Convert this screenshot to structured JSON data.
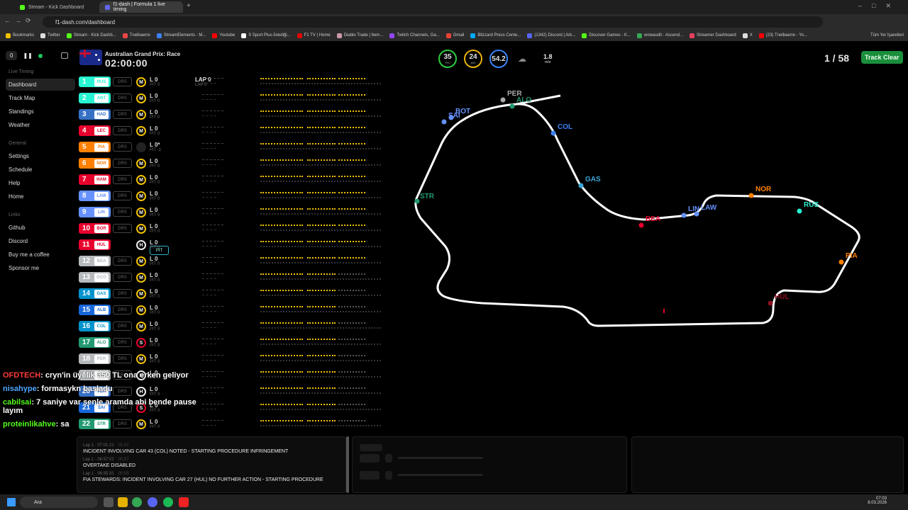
{
  "browser": {
    "tabs": [
      {
        "title": "Stream - Kick Dashboard",
        "active": false
      },
      {
        "title": "f1-dash | Formula 1 live timing",
        "active": true
      }
    ],
    "url": "f1-dash.com/dashboard",
    "bookmarks": [
      "Bookmarks",
      "Twitter",
      "Stream - Kick Dashb...",
      "Tnelbaerre",
      "StreamElements - M...",
      "Youtube",
      "S Sport Plus-İstediği...",
      "F1 TV | Home",
      "Diablo Trade | Item...",
      "Twitch Channels, Ga...",
      "Gmail",
      "Blizzard Press Cente...",
      "(1342) Discord | Ark...",
      "Discover Games - K...",
      "wowaudit - Ascend...",
      "Streamer Dashboard",
      "X",
      "(23) Tnelbaerre - Yo..."
    ],
    "all_bookmarks": "Tüm Yer İşaretleri"
  },
  "controls": {
    "counter": "0"
  },
  "sidebar": {
    "sections": [
      {
        "title": "Live Timing",
        "items": [
          "Dashboard",
          "Track Map",
          "Standings",
          "Weather"
        ]
      },
      {
        "title": "General",
        "items": [
          "Settings",
          "Schedule",
          "Help",
          "Home"
        ]
      },
      {
        "title": "Links",
        "items": [
          "Github",
          "Discord",
          "Buy me a coffee",
          "Sponsor me"
        ]
      }
    ],
    "active": "Dashboard"
  },
  "header": {
    "race": "Australian Grand Prix: Race",
    "clock": "02:00:00",
    "trc": "35",
    "trc_label": "TRC",
    "air": "24",
    "air_label": "AIR",
    "hum": "54.2",
    "wind": "1.8",
    "wind_unit": "m/s",
    "laps": "1 / 58",
    "status": "Track Clear"
  },
  "leader": {
    "lap": "LAP 0",
    "lap_sub": "LAP 0"
  },
  "drivers": [
    {
      "pos": "1",
      "code": "RUS",
      "color": "#27f4d2",
      "drs": "DRS",
      "tyre": "M",
      "lap": "L 0",
      "pit": "PIT 0"
    },
    {
      "pos": "2",
      "code": "ANT",
      "color": "#27f4d2",
      "drs": "DRS",
      "tyre": "M",
      "lap": "L 0",
      "pit": "PIT 0"
    },
    {
      "pos": "3",
      "code": "HAD",
      "color": "#3671c6",
      "drs": "DRS",
      "tyre": "M",
      "lap": "L 0",
      "pit": "PIT 0"
    },
    {
      "pos": "4",
      "code": "LEC",
      "color": "#e8002d",
      "drs": "DRS",
      "tyre": "M",
      "lap": "L 0",
      "pit": "PIT 0"
    },
    {
      "pos": "5",
      "code": "PIA",
      "color": "#ff8000",
      "drs": "DRS",
      "tyre": "",
      "lap": "L 0*",
      "pit": "PIT -1"
    },
    {
      "pos": "6",
      "code": "NOR",
      "color": "#ff8000",
      "drs": "DRS",
      "tyre": "M",
      "lap": "L 0",
      "pit": "PIT 0"
    },
    {
      "pos": "7",
      "code": "HAM",
      "color": "#e8002d",
      "drs": "DRS",
      "tyre": "M",
      "lap": "L 0",
      "pit": "PIT 0"
    },
    {
      "pos": "8",
      "code": "LAW",
      "color": "#6692ff",
      "drs": "DRS",
      "tyre": "M",
      "lap": "L 0",
      "pit": "PIT 0"
    },
    {
      "pos": "9",
      "code": "LIN",
      "color": "#6692ff",
      "drs": "DRS",
      "tyre": "M",
      "lap": "L 0",
      "pit": "PIT 0"
    },
    {
      "pos": "10",
      "code": "BOR",
      "color": "#e8002d",
      "drs": "DRS",
      "tyre": "M",
      "lap": "L 0",
      "pit": "PIT 0"
    },
    {
      "pos": "11",
      "code": "HUL",
      "color": "#e8002d",
      "drs": "PIT",
      "tyre": "H",
      "lap": "L 0",
      "pit": "PIT 0"
    },
    {
      "pos": "12",
      "code": "BEA",
      "color": "#b6babd",
      "drs": "DRS",
      "tyre": "M",
      "lap": "L 0",
      "pit": "PIT 0"
    },
    {
      "pos": "13",
      "code": "OCO",
      "color": "#b6babd",
      "drs": "DRS",
      "tyre": "M",
      "lap": "L 0",
      "pit": "PIT 0"
    },
    {
      "pos": "14",
      "code": "GAS",
      "color": "#0093cc",
      "drs": "DRS",
      "tyre": "M",
      "lap": "L 0",
      "pit": "PIT 0"
    },
    {
      "pos": "15",
      "code": "ALB",
      "color": "#1868db",
      "drs": "DRS",
      "tyre": "M",
      "lap": "L 0",
      "pit": "PIT 0"
    },
    {
      "pos": "16",
      "code": "COL",
      "color": "#0093cc",
      "drs": "DRS",
      "tyre": "M",
      "lap": "L 0",
      "pit": "PIT 0"
    },
    {
      "pos": "17",
      "code": "ALO",
      "color": "#229971",
      "drs": "DRS",
      "tyre": "S",
      "lap": "L 0",
      "pit": "PIT 0"
    },
    {
      "pos": "18",
      "code": "PER",
      "color": "#b6babd",
      "drs": "DRS",
      "tyre": "M",
      "lap": "L 0",
      "pit": "PIT 0"
    },
    {
      "pos": "19",
      "code": "BOT",
      "color": "#b6babd",
      "drs": "DRS",
      "tyre": "H",
      "lap": "L 0",
      "pit": "PIT 0"
    },
    {
      "pos": "20",
      "code": "VER",
      "color": "#3671c6",
      "drs": "DRS",
      "tyre": "H",
      "lap": "L 0",
      "pit": "PIT 0"
    },
    {
      "pos": "21",
      "code": "SAI",
      "color": "#1868db",
      "drs": "DRS",
      "tyre": "S",
      "lap": "L 0",
      "pit": "PIT 0"
    },
    {
      "pos": "22",
      "code": "STR",
      "color": "#229971",
      "drs": "DRS",
      "tyre": "M",
      "lap": "L 0",
      "pit": "PIT 0"
    }
  ],
  "chat": [
    {
      "user": "OFDTECH",
      "color": "#ff3b3b",
      "msg": ": cryn'in üyelik 350 TL ona erken geliyor"
    },
    {
      "user": "nisahype",
      "color": "#4da6ff",
      "msg": ": formasykn basladu"
    },
    {
      "user": "cabilsai",
      "color": "#53fc18",
      "msg": ": 7 saniye var senle aramda abi bende pause layım"
    },
    {
      "user": "proteinlikahve",
      "color": "#53fc18",
      "msg": ": sa"
    }
  ],
  "race_control": [
    {
      "time": "Lap 1 · 07:01:21",
      "ago": "01:01",
      "msg": "INCIDENT INVOLVING CAR 43 (COL) NOTED - STARTING PROCEDURE INFRINGEMENT"
    },
    {
      "time": "Lap 1 · 06:57:02",
      "ago": "00:57",
      "msg": "OVERTAKE DISABLED"
    },
    {
      "time": "Lap 1 · 06:55:31",
      "ago": "00:55",
      "msg": "FIA STEWARDS: INCIDENT INVOLVING CAR 27 (HUL) NO FURTHER ACTION - STARTING PROCEDURE"
    }
  ],
  "map_labels": [
    {
      "code": "PER",
      "color": "#aaaaaa"
    },
    {
      "code": "ALO",
      "color": "#229971"
    },
    {
      "code": "BOT",
      "color": "#6692ff"
    },
    {
      "code": "SAI",
      "color": "#6692ff"
    },
    {
      "code": "COL",
      "color": "#3b82f6"
    },
    {
      "code": "GAS",
      "color": "#3ba7d9"
    },
    {
      "code": "STR",
      "color": "#229971"
    },
    {
      "code": "BEA",
      "color": "#e8002d"
    },
    {
      "code": "LIN",
      "color": "#6692ff"
    },
    {
      "code": "LAW",
      "color": "#6692ff"
    },
    {
      "code": "NOR",
      "color": "#ff8000"
    },
    {
      "code": "RUS",
      "color": "#27f4d2"
    },
    {
      "code": "PIA",
      "color": "#ff8000"
    },
    {
      "code": "HUL",
      "color": "#8a1020"
    }
  ],
  "taskbar": {
    "search": "Ara",
    "time": "07:03",
    "date": "8.03.2026"
  }
}
